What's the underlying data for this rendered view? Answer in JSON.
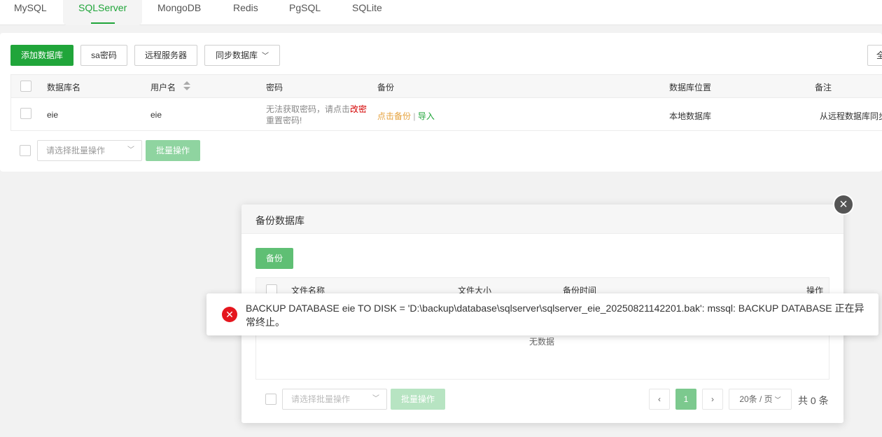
{
  "tabs": [
    {
      "label": "MySQL"
    },
    {
      "label": "SQLServer"
    },
    {
      "label": "MongoDB"
    },
    {
      "label": "Redis"
    },
    {
      "label": "PgSQL"
    },
    {
      "label": "SQLite"
    }
  ],
  "toolbar": {
    "add_db": "添加数据库",
    "sa_password": "sa密码",
    "remote_server": "远程服务器",
    "sync_db": "同步数据库",
    "right_btn": "全"
  },
  "table": {
    "headers": {
      "name": "数据库名",
      "user": "用户名",
      "password": "密码",
      "backup": "备份",
      "location": "数据库位置",
      "note": "备注"
    },
    "row": {
      "name": "eie",
      "user": "eie",
      "password_msg": "无法获取密码，请点击",
      "password_link": "改密",
      "password_msg2": "重置密码!",
      "backup_link": "点击备份",
      "separator": "|",
      "import_link": "导入",
      "location": "本地数据库",
      "note": "从远程数据库同步"
    }
  },
  "batch": {
    "select_placeholder": "请选择批量操作",
    "batch_btn": "批量操作"
  },
  "modal": {
    "title": "备份数据库",
    "backup_btn": "备份",
    "headers": {
      "file_name": "文件名称",
      "file_size": "文件大小",
      "backup_time": "备份时间",
      "actions": "操作"
    },
    "empty": "无数据",
    "batch_select": "请选择批量操作",
    "batch_btn": "批量操作",
    "page_current": "1",
    "page_size": "20条 / 页",
    "total": "共 0 条"
  },
  "toast": {
    "message": "BACKUP DATABASE eie TO DISK = 'D:\\backup\\database\\sqlserver\\sqlserver_eie_20250821142201.bak': mssql: BACKUP DATABASE 正在异常终止。"
  },
  "colors": {
    "accent": "#20a53a",
    "error": "#e5161e",
    "warning_link": "#e6a23c",
    "red_link": "#d40000"
  }
}
